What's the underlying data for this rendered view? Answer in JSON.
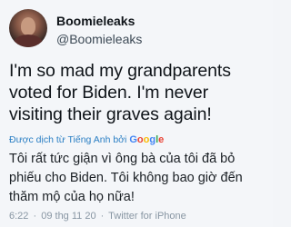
{
  "author": {
    "display_name": "Boomieleaks",
    "handle": "@Boomieleaks"
  },
  "tweet": {
    "text": "I'm so mad my grandparents voted for Biden. I'm never visiting their graves again!"
  },
  "translation": {
    "label": "Được dịch từ Tiếng Anh bởi",
    "provider_letters": [
      "G",
      "o",
      "o",
      "g",
      "l",
      "e"
    ],
    "text": "Tôi rất tức giận vì ông bà của tôi đã bỏ phiếu cho Biden. Tôi không bao giờ đến thăm mộ của họ nữa!"
  },
  "meta": {
    "time": "6:22",
    "date": "09 thg 11 20",
    "source": "Twitter for iPhone"
  },
  "colors": {
    "link": "#2b7fc4",
    "meta": "#8896a3",
    "text": "#0f1419",
    "background": "#f4f6f9"
  }
}
